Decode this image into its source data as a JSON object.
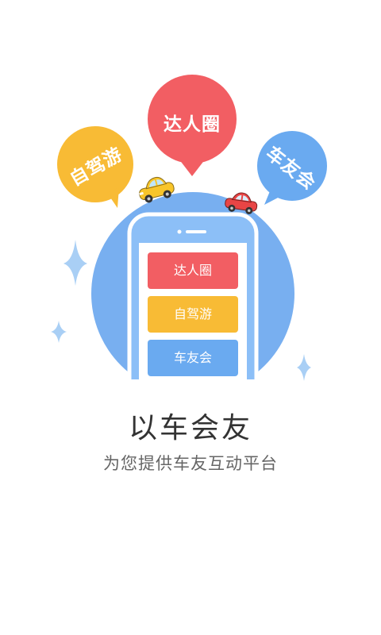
{
  "bubbles": {
    "left_label": "自驾游",
    "center_label": "达人圈",
    "right_label": "车友会"
  },
  "phone_menu": {
    "items": [
      {
        "label": "达人圈"
      },
      {
        "label": "自驾游"
      },
      {
        "label": "车友会"
      }
    ]
  },
  "tagline": {
    "title": "以车会友",
    "subtitle": "为您提供车友互动平台"
  },
  "colors": {
    "red": "#f25e63",
    "yellow": "#f8bb35",
    "blue": "#6aaaf0",
    "circle": "#78aff0",
    "phone": "#7fb6f3"
  }
}
